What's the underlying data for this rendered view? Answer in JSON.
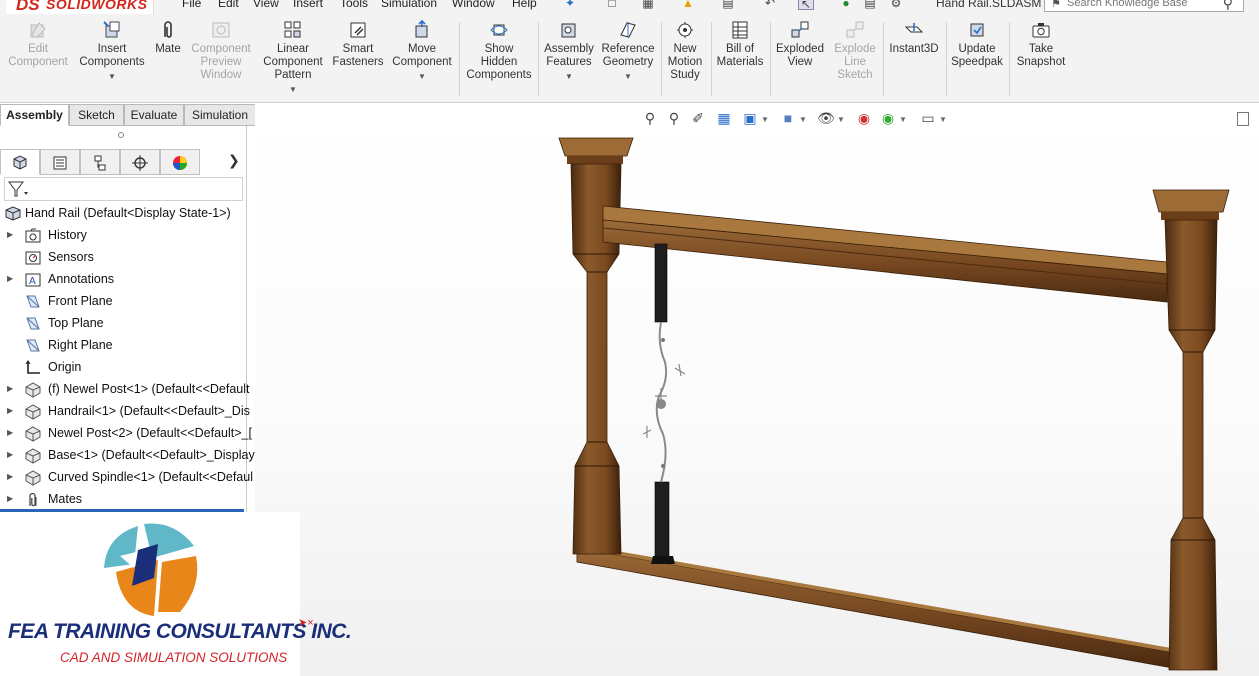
{
  "app": {
    "brand": "SOLIDWORKS",
    "document_title": "Hand Rail.SLDASM",
    "accent": "#d1271c"
  },
  "menu": [
    "File",
    "Edit",
    "View",
    "Insert",
    "Tools",
    "Simulation",
    "Window",
    "Help"
  ],
  "knowledge_search": {
    "placeholder": "Search Knowledge Base"
  },
  "toolbar": {
    "edit_component": "Edit\nComponent",
    "insert_components": "Insert\nComponents",
    "mate": "Mate",
    "component_preview": "Component\nPreview\nWindow",
    "linear_pattern": "Linear\nComponent\nPattern",
    "smart_fasteners": "Smart\nFasteners",
    "move_component": "Move\nComponent",
    "show_hidden": "Show\nHidden\nComponents",
    "assembly_features": "Assembly\nFeatures",
    "reference_geometry": "Reference\nGeometry",
    "new_motion_study": "New\nMotion\nStudy",
    "bill_of_materials": "Bill of\nMaterials",
    "exploded_view": "Exploded\nView",
    "explode_line_sketch": "Explode\nLine\nSketch",
    "instant3d": "Instant3D",
    "update_speedpak": "Update\nSpeedpak",
    "take_snapshot": "Take\nSnapshot"
  },
  "tabs": [
    "Assembly",
    "Sketch",
    "Evaluate",
    "Simulation"
  ],
  "tree": {
    "root": "Hand Rail  (Default<Display State-1>)",
    "items": [
      {
        "label": "History",
        "icon": "history-folder-icon",
        "expand": true
      },
      {
        "label": "Sensors",
        "icon": "sensor-icon",
        "expand": false
      },
      {
        "label": "Annotations",
        "icon": "annotation-icon",
        "expand": true
      },
      {
        "label": "Front Plane",
        "icon": "plane-icon",
        "expand": false
      },
      {
        "label": "Top Plane",
        "icon": "plane-icon",
        "expand": false
      },
      {
        "label": "Right Plane",
        "icon": "plane-icon",
        "expand": false
      },
      {
        "label": "Origin",
        "icon": "origin-icon",
        "expand": false
      },
      {
        "label": "(f) Newel Post<1> (Default<<Default",
        "icon": "part-icon",
        "expand": true
      },
      {
        "label": "Handrail<1> (Default<<Default>_Dis",
        "icon": "part-icon",
        "expand": true
      },
      {
        "label": "Newel Post<2> (Default<<Default>_[",
        "icon": "part-icon",
        "expand": true
      },
      {
        "label": "Base<1> (Default<<Default>_Display",
        "icon": "part-icon",
        "expand": true
      },
      {
        "label": "Curved Spindle<1> (Default<<Defaul",
        "icon": "part-icon",
        "expand": true
      },
      {
        "label": "Mates",
        "icon": "mates-icon",
        "expand": true
      }
    ]
  },
  "watermark": {
    "company": "FEA TRAINING  CONSULTANTS INC.",
    "tagline": "CAD AND SIMULATION SOLUTIONS",
    "colors": {
      "navy": "#1b2e7a",
      "red": "#d5232a",
      "orange": "#e8861a",
      "teal": "#5fb7c8"
    }
  },
  "model_colors": {
    "wood_light": "#8b5a2b",
    "wood_dark": "#5a3515",
    "spindle": "#222222",
    "wire": "#888888"
  }
}
